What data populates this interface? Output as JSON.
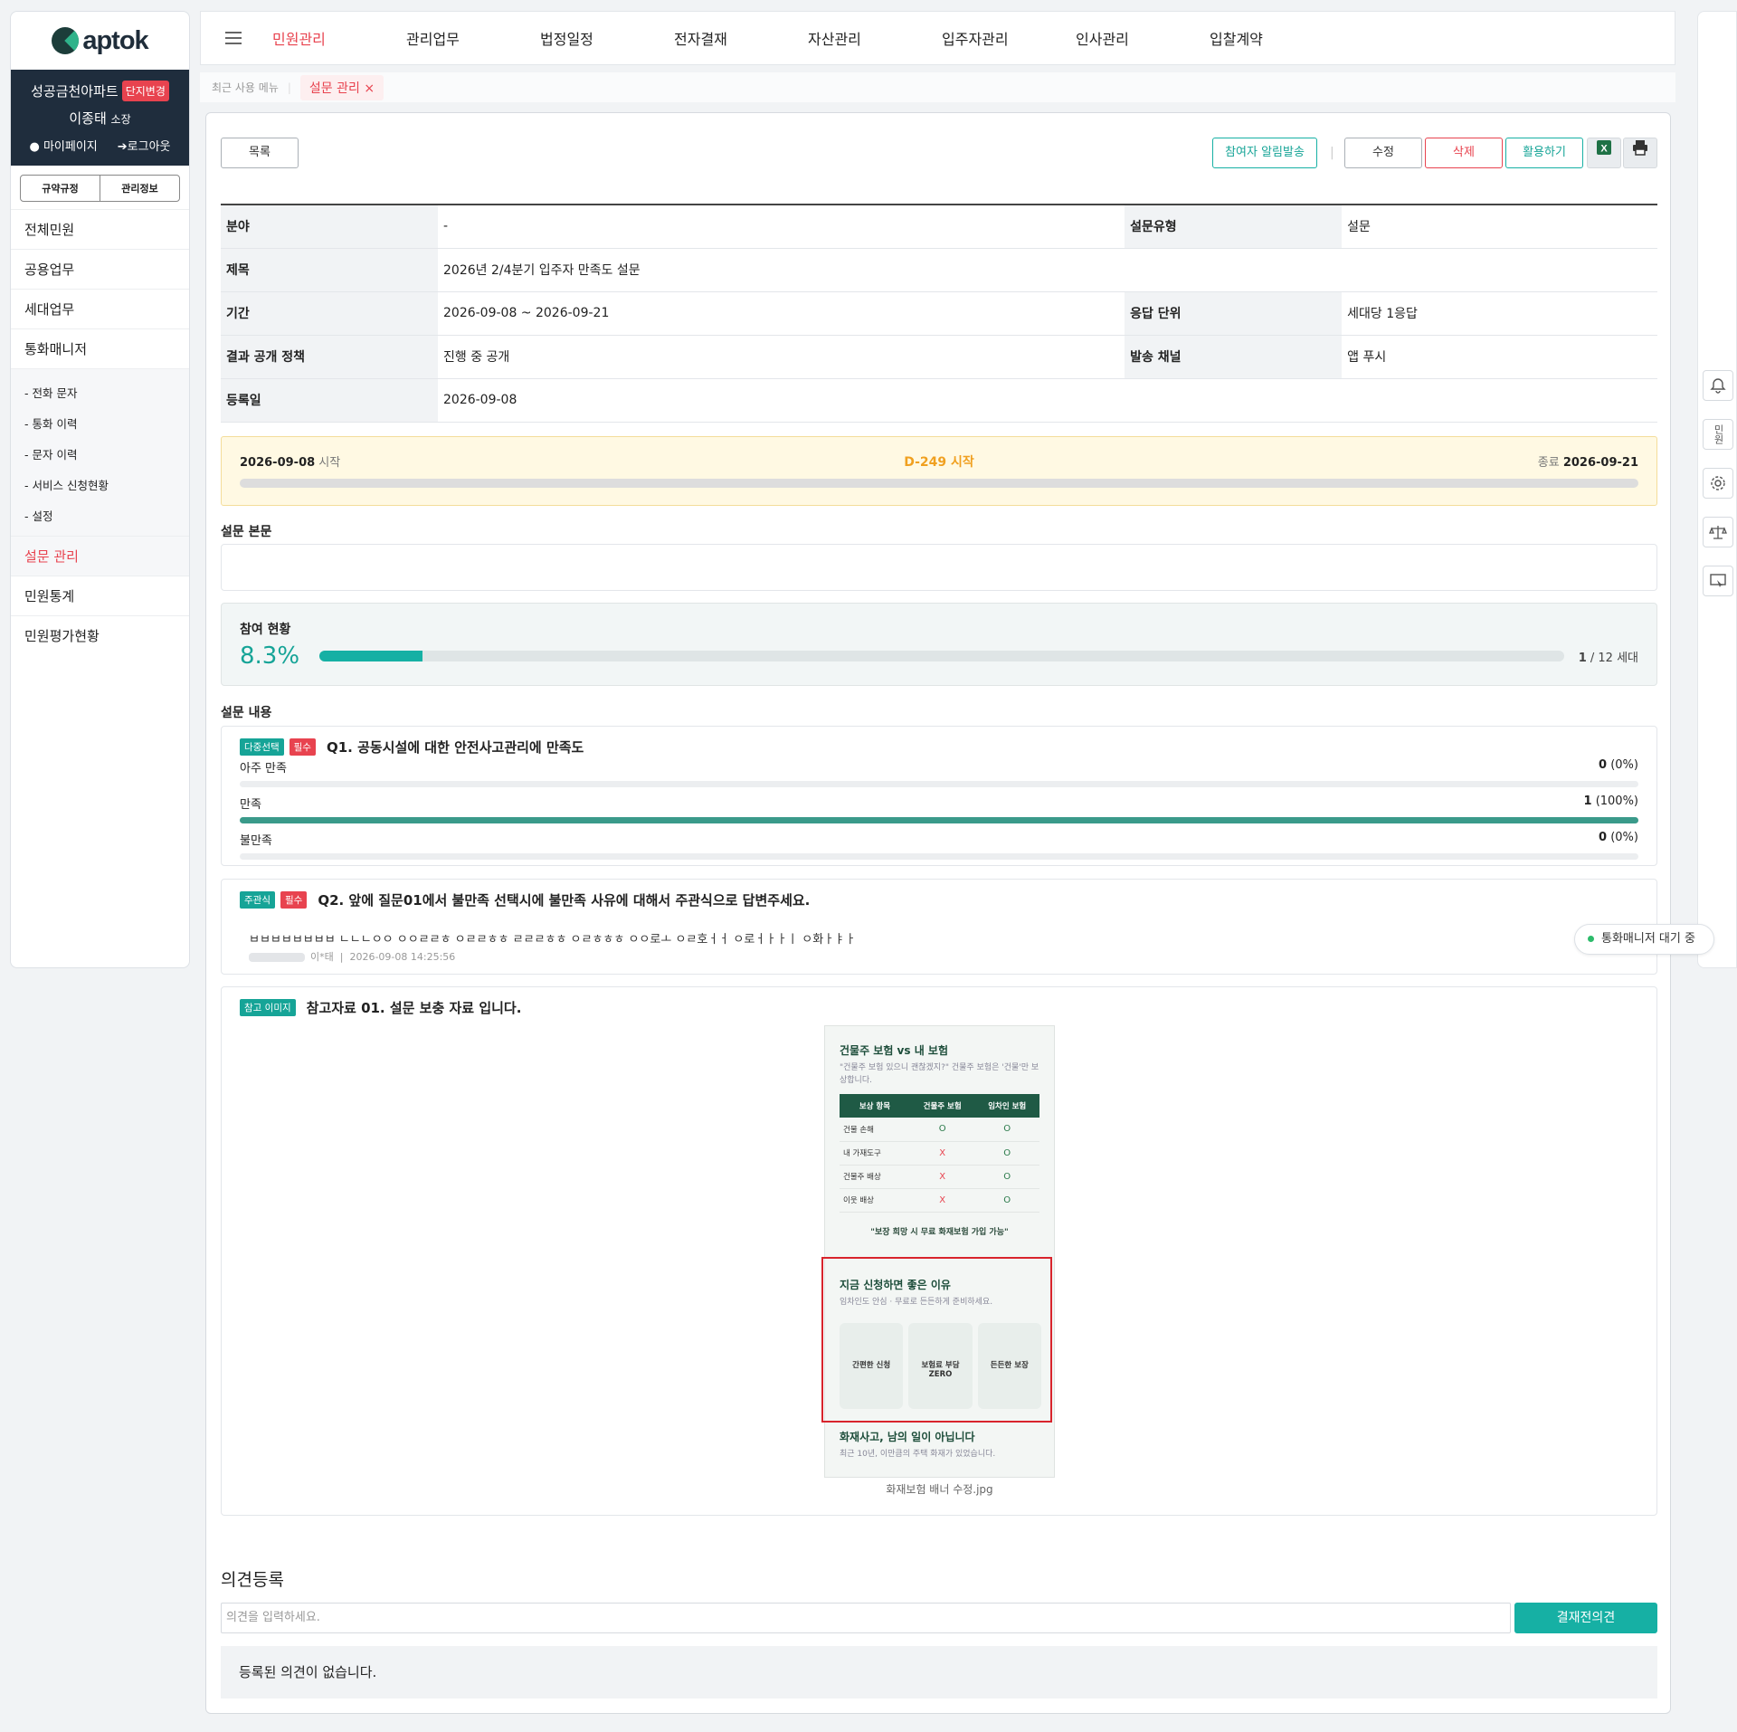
{
  "brand": "aptok",
  "user": {
    "complex": "성공금천아파트",
    "change": "단지변경",
    "name": "이종태",
    "role": "소장",
    "mypage": "마이페이지",
    "logout": "로그아웃"
  },
  "subtabs": [
    "규약규정",
    "관리정보"
  ],
  "menu": [
    "전체민원",
    "공용업무",
    "세대업무",
    "통화매니저"
  ],
  "submenu": [
    "- 전화 문자",
    "- 통화 이력",
    "- 문자 이력",
    "- 서비스 신청현황",
    "- 설정"
  ],
  "menu2": [
    "설문 관리",
    "민원통계",
    "민원평가현황"
  ],
  "topnav": [
    "민원관리",
    "관리업무",
    "법정일정",
    "전자결재",
    "자산관리",
    "입주자관리",
    "인사관리",
    "입찰계약"
  ],
  "recent": {
    "label": "최근 사용 메뉴",
    "tab": "설문 관리",
    "close": "×"
  },
  "buttons": {
    "list": "목록",
    "notify": "참여자 알림발송",
    "edit": "수정",
    "delete": "삭제",
    "use": "활용하기"
  },
  "info": {
    "field_l": "분야",
    "field_v": "-",
    "type_l": "설문유형",
    "type_v": "설문",
    "title_l": "제목",
    "title_v": "2026년 2/4분기 입주자 만족도 설문",
    "period_l": "기간",
    "period_v": "2026-09-08 ~ 2026-09-21",
    "unit_l": "응답 단위",
    "unit_v": "세대당 1응답",
    "policy_l": "결과 공개 정책",
    "policy_v": "진행 중 공개",
    "channel_l": "발송 채널",
    "channel_v": "앱 푸시",
    "reg_l": "등록일",
    "reg_v": "2026-09-08"
  },
  "period": {
    "start": "2026-09-08",
    "start_suffix": "시작",
    "dday": "D-249 시작",
    "end_prefix": "종료",
    "end": "2026-09-21"
  },
  "body_title": "설문 본문",
  "participation": {
    "title": "참여 현황",
    "pct": "8.3%",
    "fraction": 0.083,
    "count": "1",
    "total": "/ 12 세대"
  },
  "content_title": "설문 내용",
  "q1": {
    "tag1": "다중선택",
    "tag2": "필수",
    "text": "Q1. 공동시설에 대한 안전사고관리에 만족도",
    "options": [
      {
        "label": "아주 만족",
        "count": "0",
        "pct": "(0%)",
        "fraction": 0
      },
      {
        "label": "만족",
        "count": "1",
        "pct": "(100%)",
        "fraction": 1
      },
      {
        "label": "불만족",
        "count": "0",
        "pct": "(0%)",
        "fraction": 0
      }
    ]
  },
  "q2": {
    "tag1": "주관식",
    "tag2": "필수",
    "text": "Q2. 앞에 질문01에서 불만족 선택시에 불만족 사유에 대해서 주관식으로 답변주세요.",
    "answer": "ㅂㅂㅂㅂㅂㅂㅂㅂ ㄴㄴㄴㅇㅇ ㅇㅇㄹㄹㅎ ㅇㄹㄹㅎㅎ ㄹㄹㄹㅎㅎ ㅇㄹㅎㅎㅎ ㅇㅇ로ㅗ ㅇㄹ호ㅓㅓ ㅇ로ㅓㅏㅏㅣ ㅇ화ㅏㅑㅏ",
    "author": "이*태",
    "date": "2026-09-08 14:25:56"
  },
  "ref": {
    "tag": "참고 이미지",
    "text": "참고자료 01. 설문 보충 자료 입니다.",
    "caption": "화재보험 배너 수정.jpg",
    "img": {
      "h1": "건물주 보험 vs 내 보험",
      "s1": "\"건물주 보험 있으니 괜찮겠지?\" 건물주 보험은 '건물'만 보상합니다.",
      "cols": [
        "보상 항목",
        "건물주 보험",
        "임차인 보험"
      ],
      "rows": [
        [
          "건물 손해",
          "O",
          "O"
        ],
        [
          "내 가재도구",
          "X",
          "O"
        ],
        [
          "건물주 배상",
          "X",
          "O"
        ],
        [
          "이웃 배상",
          "X",
          "O"
        ]
      ],
      "note": "\"보장 희망 시 무료 화재보험 가입 가능\"",
      "h2": "지금 신청하면 좋은 이유",
      "s2": "임차인도 안심 · 무료로 든든하게 준비하세요.",
      "r1": "간편한 신청",
      "r2": "보험료 부담 ZERO",
      "r3": "든든한 보장",
      "h3": "화재사고, 남의 일이 아닙니다",
      "s3": "최근 10년, 이만큼의 주택 화재가 있었습니다."
    }
  },
  "opinion": {
    "title": "의견등록",
    "placeholder": "의견을 입력하세요.",
    "submit": "결재전의견",
    "empty": "등록된 의견이 없습니다."
  },
  "right": {
    "civil": "민원",
    "call": "통화매니저 대기 중"
  },
  "icons": {
    "bell": "bell-icon",
    "gear": "gear-icon",
    "scale": "scale-icon",
    "monitor": "monitor-icon",
    "excel": "excel-icon",
    "print": "print-icon"
  }
}
